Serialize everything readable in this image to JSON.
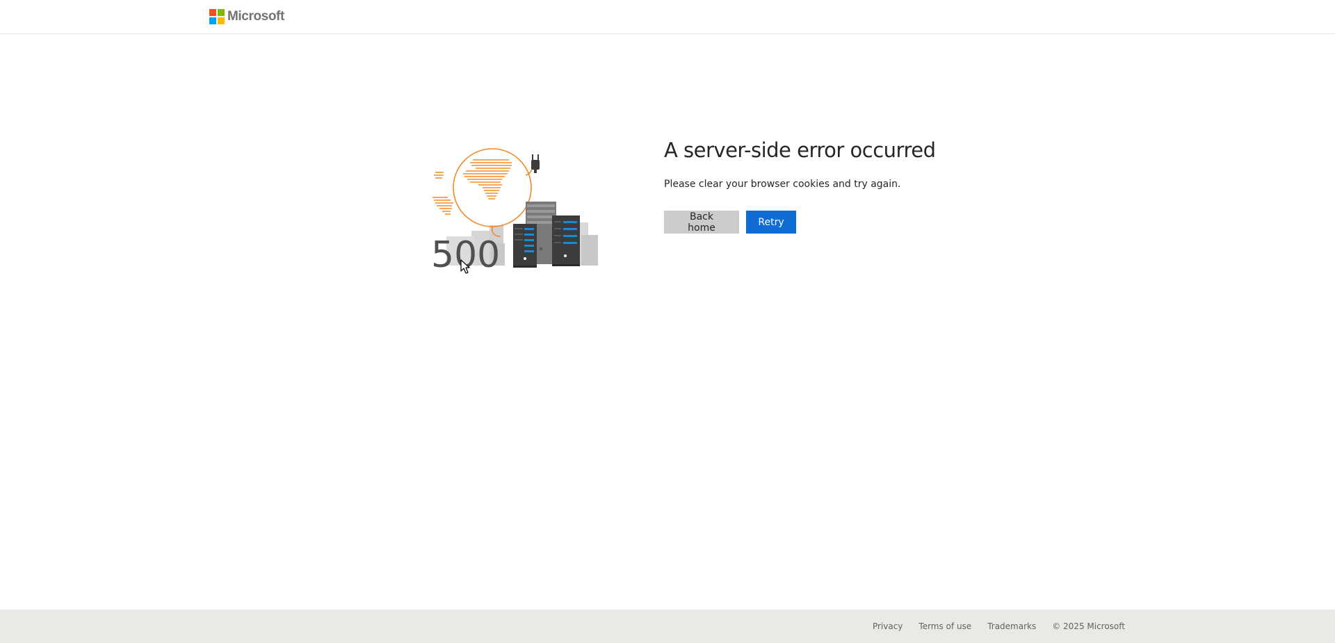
{
  "header": {
    "brand_name": "Microsoft",
    "logo_colors": [
      "#f25022",
      "#7fba00",
      "#00a4ef",
      "#ffb900"
    ]
  },
  "illustration": {
    "code": "500",
    "icon": "server-error-illustration",
    "accent_color": "#f08a24",
    "server_light_color": "#1a8ad4"
  },
  "main": {
    "title": "A server-side error occurred",
    "message": "Please clear your browser cookies and try again.",
    "back_label": "Back home",
    "retry_label": "Retry",
    "primary_color": "#0f6cd4"
  },
  "footer": {
    "links": [
      "Privacy",
      "Terms of use",
      "Trademarks"
    ],
    "copyright": "© 2025 Microsoft"
  }
}
